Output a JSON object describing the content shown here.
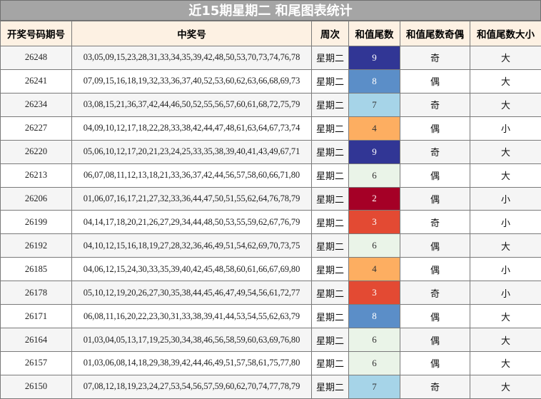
{
  "title": "近15期星期二 和尾图表统计",
  "headers": {
    "issue": "开奖号码期号",
    "numbers": "中奖号",
    "week": "周次",
    "tail": "和值尾数",
    "parity": "和值尾数奇偶",
    "size": "和值尾数大小"
  },
  "tail_colors": {
    "0": "#eaf4e8",
    "1": "#eaf4e8",
    "2": "#a50026",
    "3": "#e34a33",
    "4": "#fdae61",
    "5": "#fee090",
    "6": "#eaf4e8",
    "7": "#a6d4e8",
    "8": "#5b8ec8",
    "9": "#313695"
  },
  "tail_text_colors": {
    "0": "#333333",
    "1": "#333333",
    "2": "#ffffff",
    "3": "#ffffff",
    "4": "#333333",
    "5": "#333333",
    "6": "#333333",
    "7": "#333333",
    "8": "#ffffff",
    "9": "#ffffff"
  },
  "rows": [
    {
      "issue": "26248",
      "numbers": "03,05,09,15,23,28,31,33,34,35,39,42,48,50,53,70,73,74,76,78",
      "week": "星期二",
      "tail": "9",
      "parity": "奇",
      "size": "大"
    },
    {
      "issue": "26241",
      "numbers": "07,09,15,16,18,19,32,33,36,37,40,52,53,60,62,63,66,68,69,73",
      "week": "星期二",
      "tail": "8",
      "parity": "偶",
      "size": "大"
    },
    {
      "issue": "26234",
      "numbers": "03,08,15,21,36,37,42,44,46,50,52,55,56,57,60,61,68,72,75,79",
      "week": "星期二",
      "tail": "7",
      "parity": "奇",
      "size": "大"
    },
    {
      "issue": "26227",
      "numbers": "04,09,10,12,17,18,22,28,33,38,42,44,47,48,61,63,64,67,73,74",
      "week": "星期二",
      "tail": "4",
      "parity": "偶",
      "size": "小"
    },
    {
      "issue": "26220",
      "numbers": "05,06,10,12,17,20,21,23,24,25,33,35,38,39,40,41,43,49,67,71",
      "week": "星期二",
      "tail": "9",
      "parity": "奇",
      "size": "大"
    },
    {
      "issue": "26213",
      "numbers": "06,07,08,11,12,13,18,21,33,36,37,42,44,56,57,58,60,66,71,80",
      "week": "星期二",
      "tail": "6",
      "parity": "偶",
      "size": "大"
    },
    {
      "issue": "26206",
      "numbers": "01,06,07,16,17,21,27,32,33,36,44,47,50,51,55,62,64,76,78,79",
      "week": "星期二",
      "tail": "2",
      "parity": "偶",
      "size": "小"
    },
    {
      "issue": "26199",
      "numbers": "04,14,17,18,20,21,26,27,29,34,44,48,50,53,55,59,62,67,76,79",
      "week": "星期二",
      "tail": "3",
      "parity": "奇",
      "size": "小"
    },
    {
      "issue": "26192",
      "numbers": "04,10,12,15,16,18,19,27,28,32,36,46,49,51,54,62,69,70,73,75",
      "week": "星期二",
      "tail": "6",
      "parity": "偶",
      "size": "大"
    },
    {
      "issue": "26185",
      "numbers": "04,06,12,15,24,30,33,35,39,40,42,45,48,58,60,61,66,67,69,80",
      "week": "星期二",
      "tail": "4",
      "parity": "偶",
      "size": "小"
    },
    {
      "issue": "26178",
      "numbers": "05,10,12,19,20,26,27,30,35,38,44,45,46,47,49,54,56,61,72,77",
      "week": "星期二",
      "tail": "3",
      "parity": "奇",
      "size": "小"
    },
    {
      "issue": "26171",
      "numbers": "06,08,11,16,20,22,23,30,31,33,38,39,41,44,53,54,55,62,63,79",
      "week": "星期二",
      "tail": "8",
      "parity": "偶",
      "size": "大"
    },
    {
      "issue": "26164",
      "numbers": "01,03,04,05,13,17,19,25,30,34,38,46,56,58,59,60,63,69,76,80",
      "week": "星期二",
      "tail": "6",
      "parity": "偶",
      "size": "大"
    },
    {
      "issue": "26157",
      "numbers": "01,03,06,08,14,18,29,38,39,42,44,46,49,51,57,58,61,75,77,80",
      "week": "星期二",
      "tail": "6",
      "parity": "偶",
      "size": "大"
    },
    {
      "issue": "26150",
      "numbers": "07,08,12,18,19,23,24,27,53,54,56,57,59,60,62,70,74,77,78,79",
      "week": "星期二",
      "tail": "7",
      "parity": "奇",
      "size": "大"
    }
  ]
}
